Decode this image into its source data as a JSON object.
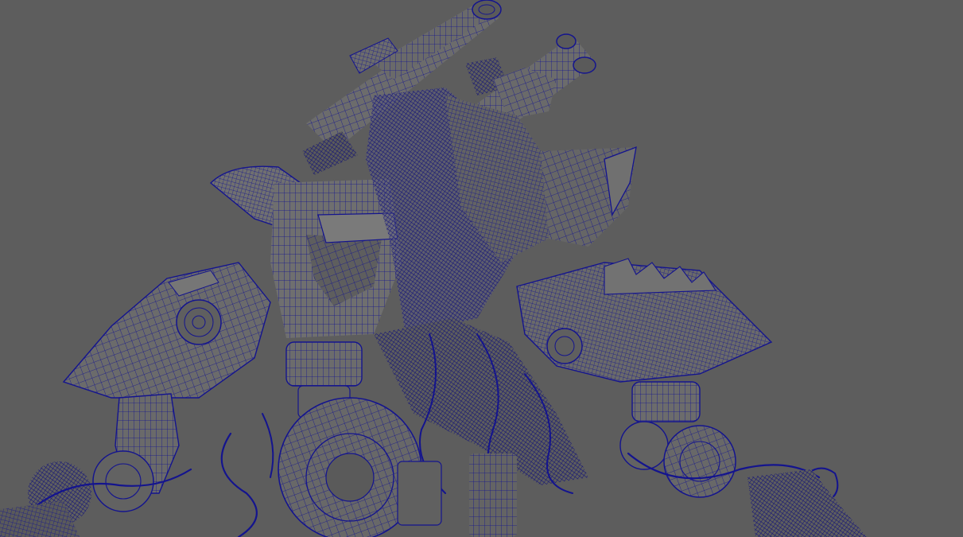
{
  "viewport": {
    "background": "#5d5d5d",
    "mesh_fill": "#6c6c6c",
    "mesh_fill_dark": "#4e4e4e",
    "mesh_fill_light": "#7e7e7e",
    "wire_color": "#14148e",
    "wire_color_dense": "#0c0c7a"
  },
  "model": {
    "display_mode": "wireframe-on-shaded",
    "parts": [
      "left-cannon-icon",
      "right-cannon-icon",
      "left-shoulder-armor-icon",
      "right-shoulder-armor-icon",
      "center-torso-icon",
      "left-arm-icon",
      "right-arm-icon",
      "left-hip-joint-icon",
      "right-hip-joint-icon",
      "center-wheel-icon",
      "left-foot-icon",
      "right-foot-icon"
    ]
  }
}
